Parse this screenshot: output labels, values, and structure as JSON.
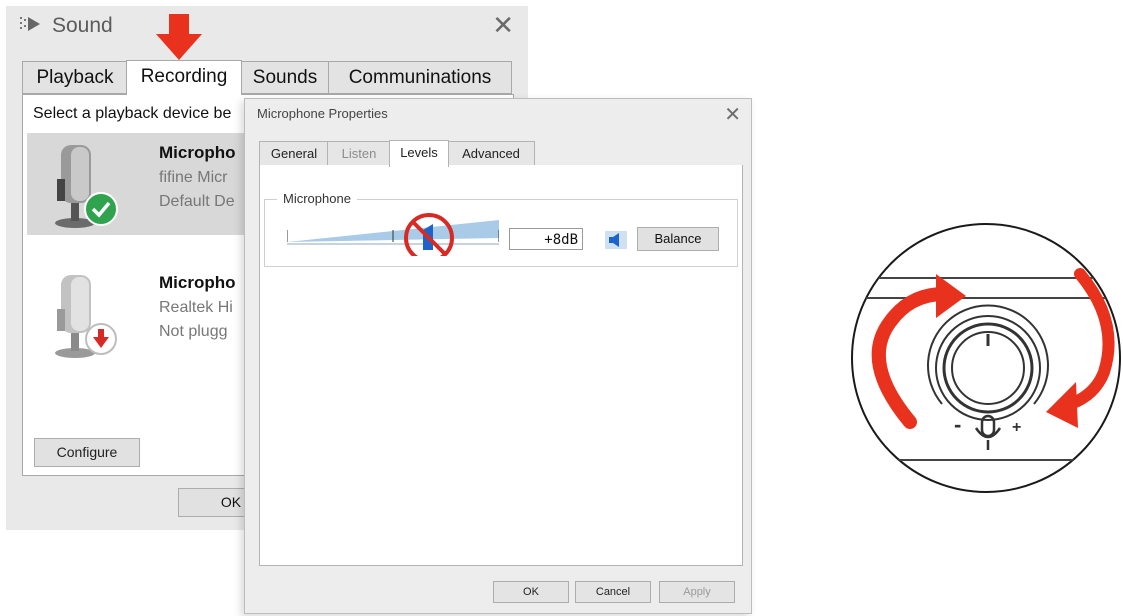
{
  "sound": {
    "title": "Sound",
    "close": "✕",
    "tabs": [
      {
        "label": "Playback"
      },
      {
        "label": "Recording"
      },
      {
        "label": "Sounds"
      },
      {
        "label": "Communinations"
      }
    ],
    "instruction": "Select a playback device be",
    "devices": [
      {
        "name": "Micropho",
        "sub": "fifine Micr",
        "status": "Default De",
        "badge": "check-icon"
      },
      {
        "name": "Micropho",
        "sub": "Realtek Hi",
        "status": "Not plugg",
        "badge": "arrow-down-icon"
      }
    ],
    "configure_label": "Configure",
    "ok_label": "OK"
  },
  "props": {
    "title": "Microphone Properties",
    "close": "✕",
    "tabs": [
      {
        "label": "General"
      },
      {
        "label": "Listen"
      },
      {
        "label": "Levels"
      },
      {
        "label": "Advanced"
      }
    ],
    "group_label": "Microphone",
    "level": "+8dB",
    "balance_label": "Balance",
    "ok_label": "OK",
    "cancel_label": "Cancel",
    "apply_label": "Apply"
  },
  "annotation": {
    "knob_minus": "-",
    "knob_plus": "+"
  },
  "colors": {
    "annotation_red": "#e8321e",
    "check_green": "#2fa34d",
    "slider_blue": "#1e64c8"
  }
}
